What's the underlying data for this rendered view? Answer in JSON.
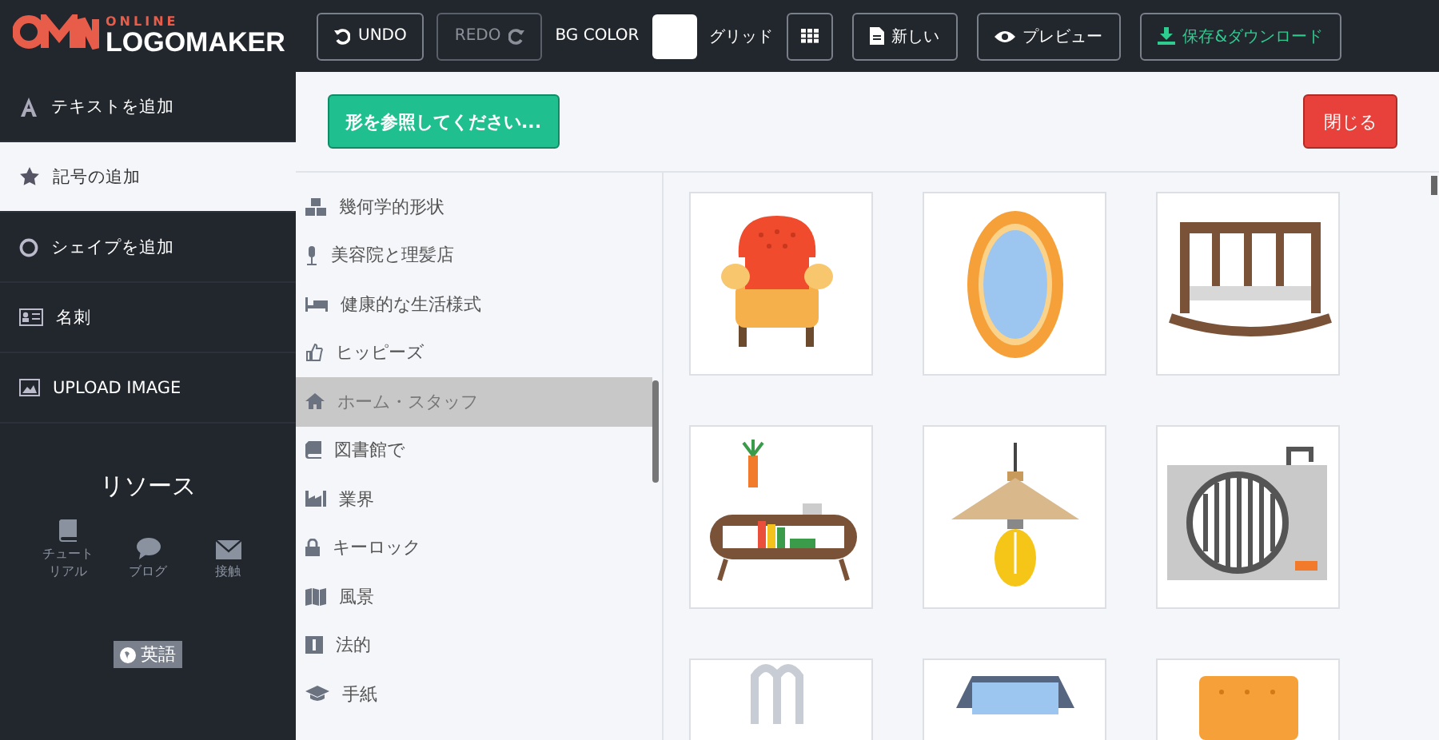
{
  "header": {
    "logo": {
      "top": "ONLINE",
      "main": "LOGOMAKER"
    },
    "undo": {
      "label": "UNDO",
      "disabled": false
    },
    "redo": {
      "label": "REDO",
      "disabled": true
    },
    "bg_color": {
      "label": "BG COLOR",
      "color": "#ffffff"
    },
    "grid": {
      "label": "グリッド"
    },
    "actions": [
      {
        "label": "新しい",
        "kind": "file"
      },
      {
        "label": "プレビュー",
        "kind": "eye"
      },
      {
        "label": "保存&ダウンロード",
        "kind": "download"
      }
    ]
  },
  "sidebar": {
    "items": [
      {
        "label": "テキストを追加",
        "kind": "text",
        "selected": false
      },
      {
        "label": "記号の追加",
        "kind": "star",
        "selected": true
      },
      {
        "label": "シェイプを追加",
        "kind": "circle",
        "selected": false
      },
      {
        "label": "名刺",
        "kind": "card",
        "selected": false
      },
      {
        "label": "UPLOAD IMAGE",
        "kind": "image",
        "selected": false
      }
    ],
    "resources": {
      "title": "リソース",
      "links": [
        {
          "label": "チュートリアル",
          "kind": "book"
        },
        {
          "label": "ブログ",
          "kind": "chat"
        },
        {
          "label": "接触",
          "kind": "mail"
        }
      ]
    },
    "language": "英語"
  },
  "toolbar": {
    "browse": "形を参照してください...",
    "close": "閉じる"
  },
  "categories": [
    {
      "label": "幾何学的形状",
      "kind": "cubes",
      "selected": false
    },
    {
      "label": "美容院と理髪店",
      "kind": "mic",
      "selected": false
    },
    {
      "label": "健康的な生活様式",
      "kind": "bed",
      "selected": false
    },
    {
      "label": "ヒッピーズ",
      "kind": "thumb",
      "selected": false
    },
    {
      "label": "ホーム・スタッフ",
      "kind": "home",
      "selected": true
    },
    {
      "label": "図書館で",
      "kind": "book",
      "selected": false
    },
    {
      "label": "業界",
      "kind": "factory",
      "selected": false
    },
    {
      "label": "キーロック",
      "kind": "lock",
      "selected": false
    },
    {
      "label": "風景",
      "kind": "map",
      "selected": false
    },
    {
      "label": "法的",
      "kind": "legal",
      "selected": false
    },
    {
      "label": "手紙",
      "kind": "cap",
      "selected": false
    }
  ],
  "shapes": [
    {
      "kind": "armchair"
    },
    {
      "kind": "mirror"
    },
    {
      "kind": "crib"
    },
    {
      "kind": "shelf"
    },
    {
      "kind": "lamp"
    },
    {
      "kind": "heater"
    },
    {
      "kind": "radiator"
    },
    {
      "kind": "window"
    },
    {
      "kind": "cushion"
    }
  ]
}
